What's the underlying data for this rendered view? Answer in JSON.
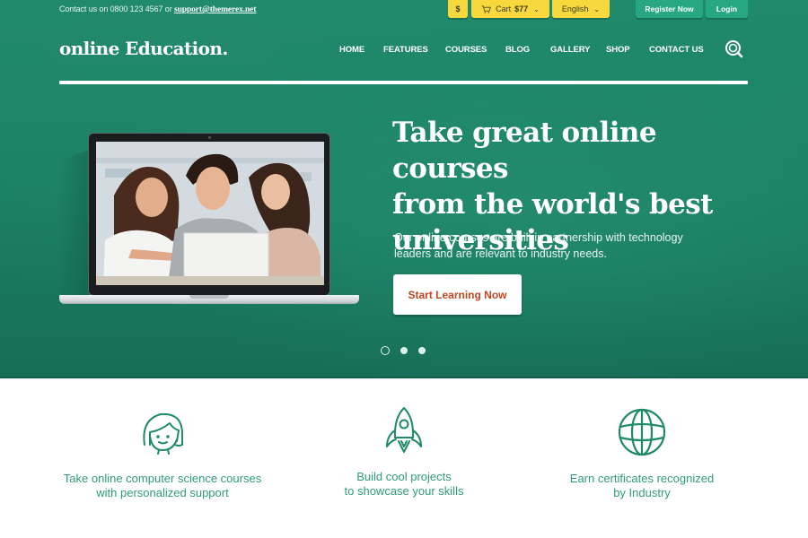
{
  "topbar": {
    "contact_prefix": "Contact us on 0800 123 4567 or ",
    "contact_email": "support@themerex.net",
    "currency_label": "$",
    "cart_label": "Cart",
    "cart_total": "$77",
    "language_label": "English",
    "register_label": "Register Now",
    "login_label": "Login"
  },
  "header": {
    "logo": "online Education.",
    "nav": [
      "HOME",
      "FEATURES",
      "COURSES",
      "BLOG",
      "GALLERY",
      "SHOP",
      "CONTACT US"
    ]
  },
  "hero": {
    "headline_lines": [
      "Take great online courses",
      "from the world's best",
      "universities"
    ],
    "subtext_lines": [
      "Our online courses are built in partnership with technology",
      "leaders and are relevant to industry needs."
    ],
    "cta_label": "Start Learning Now",
    "slides": {
      "count": 3,
      "active_index": 0
    }
  },
  "features": [
    {
      "icon": "girl-face-icon",
      "lines": [
        "Take online computer science courses",
        "with personalized support"
      ]
    },
    {
      "icon": "rocket-icon",
      "lines": [
        "Build cool projects",
        "to showcase your skills"
      ]
    },
    {
      "icon": "globe-icon",
      "lines": [
        "Earn certificates recognized",
        "by Industry"
      ]
    }
  ],
  "colors": {
    "hero_green": "#1b7f62",
    "accent_yellow": "#f7d93d",
    "button_green": "#27a883",
    "cta_text": "#c2451e",
    "feature_text": "#2e9c78"
  }
}
